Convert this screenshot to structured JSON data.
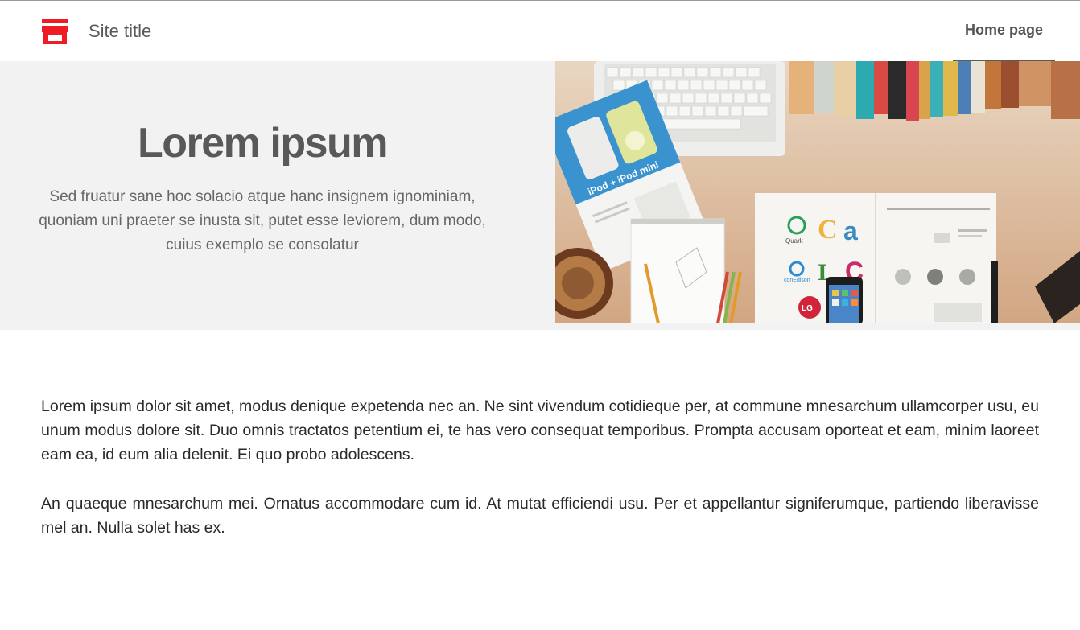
{
  "header": {
    "site_title": "Site title",
    "brand_icon": "store-icon",
    "brand_color": "#ee1c25",
    "nav": [
      {
        "label": "Home page",
        "active": true
      }
    ]
  },
  "hero": {
    "heading": "Lorem ipsum",
    "subtitle": "Sed fruatur sane hoc solacio atque hanc insignem ignominiam, quoniam uni praeter se inusta sit, putet esse leviorem, dum modo, cuius exemplo se consolatur",
    "image_labels": {
      "ipod_cover": "iPod + iPod mini",
      "logo_quark": "Quark",
      "logo_conedison": "conEdison",
      "logo_lg": "LG"
    },
    "background_color": "#f2f2f2"
  },
  "content": {
    "paragraphs": [
      "Lorem ipsum dolor sit amet, modus denique expetenda nec an. Ne sint vivendum cotidieque per, at commune mnesarchum ullamcorper usu, eu unum modus dolore sit. Duo omnis tractatos petentium ei, te has vero consequat temporibus. Prompta accusam oporteat et eam, minim laoreet eam ea, id eum alia delenit. Ei quo probo adolescens.",
      "An quaeque mnesarchum mei. Ornatus accommodare cum id. At mutat efficiendi usu. Per et appellantur signiferumque, partiendo liberavisse mel an. Nulla solet has ex."
    ]
  }
}
